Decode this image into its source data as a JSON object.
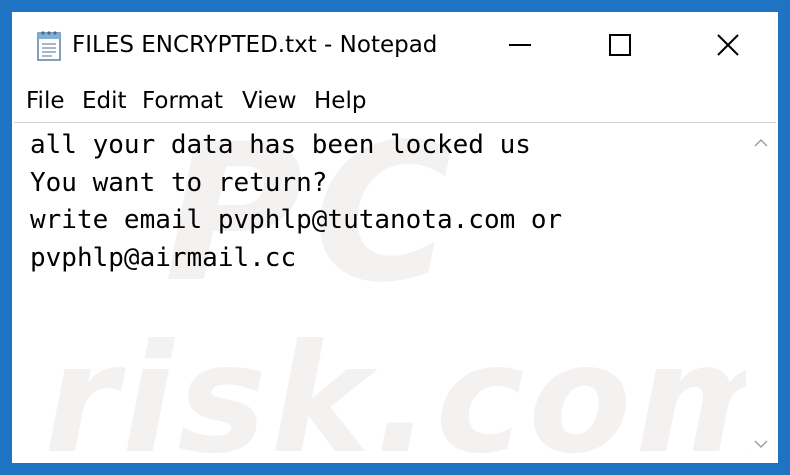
{
  "window": {
    "title": "FILES ENCRYPTED.txt - Notepad",
    "icon": "notepad-icon",
    "controls": {
      "minimize_icon": "minimize-icon",
      "maximize_icon": "maximize-icon",
      "close_icon": "close-icon"
    }
  },
  "menu": {
    "items": [
      {
        "label": "File"
      },
      {
        "label": "Edit"
      },
      {
        "label": "Format"
      },
      {
        "label": "View"
      },
      {
        "label": "Help"
      }
    ]
  },
  "document": {
    "lines": [
      "all your data has been locked us",
      "You want to return?",
      "write email pvphlp@tutanota.com or",
      "pvphlp@airmail.cc"
    ]
  },
  "watermark": {
    "text_top": "PC",
    "text_bottom": "risk.com"
  },
  "scrollbar": {
    "up_icon": "scroll-up-arrow-icon",
    "down_icon": "scroll-down-arrow-icon"
  },
  "colors": {
    "window_border": "#1e73c2",
    "background": "#ffffff",
    "text": "#000000"
  }
}
